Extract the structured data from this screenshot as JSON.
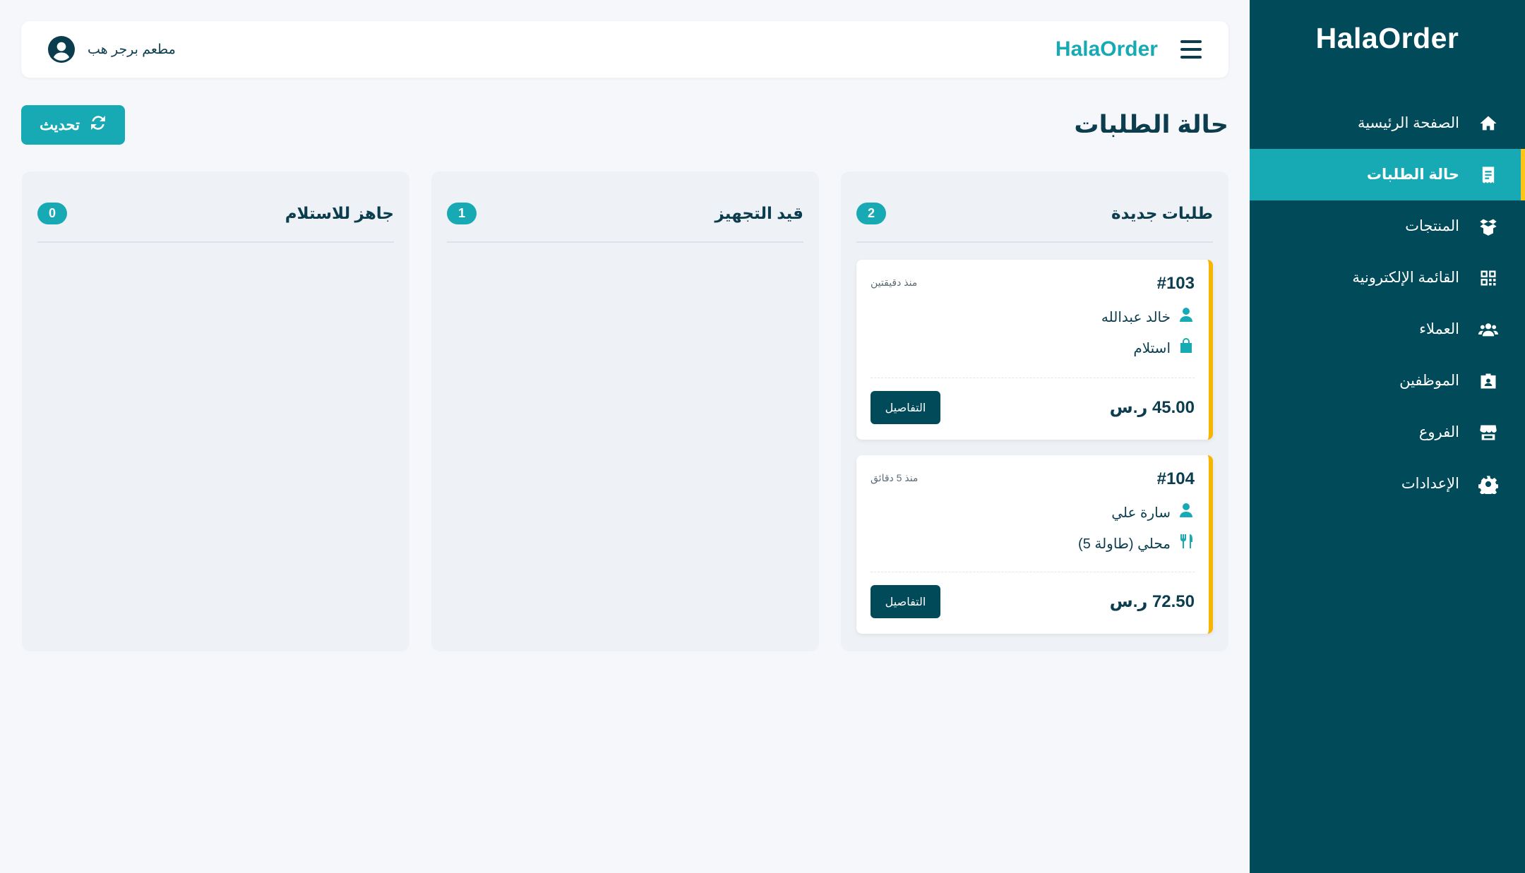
{
  "sidebar": {
    "brand": "HalaOrder",
    "items": [
      {
        "label": "الصفحة الرئيسية",
        "icon": "home-icon"
      },
      {
        "label": "حالة الطلبات",
        "icon": "receipt-icon",
        "active": true
      },
      {
        "label": "المنتجات",
        "icon": "box-open-icon"
      },
      {
        "label": "القائمة الإلكترونية",
        "icon": "qrcode-icon"
      },
      {
        "label": "العملاء",
        "icon": "users-icon"
      },
      {
        "label": "الموظفين",
        "icon": "id-badge-icon"
      },
      {
        "label": "الفروع",
        "icon": "store-icon"
      },
      {
        "label": "الإعدادات",
        "icon": "gear-icon"
      }
    ]
  },
  "topbar": {
    "brand": "HalaOrder",
    "user_name": "مطعم برجر هب"
  },
  "page": {
    "title": "حالة الطلبات",
    "refresh_label": "تحديث"
  },
  "columns": [
    {
      "title": "طلبات جديدة",
      "count": "2",
      "orders": [
        {
          "id": "#103",
          "time": "منذ دقيقتين",
          "customer": "خالد عبدالله",
          "type": "استلام",
          "type_icon": "shopping-bag-icon",
          "total": "45.00 ر.س",
          "details_label": "التفاصيل"
        },
        {
          "id": "#104",
          "time": "منذ 5 دقائق",
          "customer": "سارة علي",
          "type": "محلي (طاولة 5)",
          "type_icon": "utensils-icon",
          "total": "72.50 ر.س",
          "details_label": "التفاصيل"
        }
      ]
    },
    {
      "title": "قيد التجهيز",
      "count": "1",
      "orders": []
    },
    {
      "title": "جاهز للاستلام",
      "count": "0",
      "orders": []
    }
  ],
  "colors": {
    "sidebar_bg": "#004a5a",
    "accent": "#17aab5",
    "card_border": "#f5b500",
    "text_dark": "#0b3d4e"
  }
}
